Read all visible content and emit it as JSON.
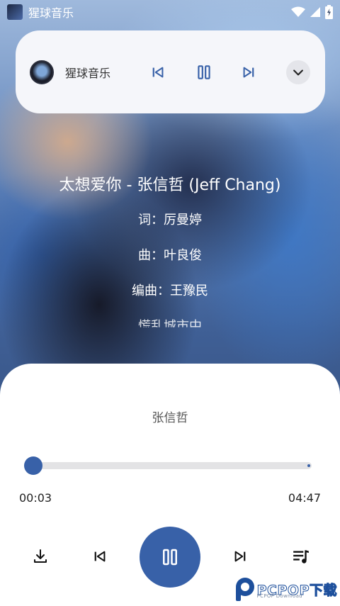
{
  "status_bar": {
    "app_name": "猩球音乐"
  },
  "mini_player": {
    "title": "猩球音乐"
  },
  "lyrics": {
    "lines": [
      "太想爱你 - 张信哲 (Jeff Chang)",
      "词：厉曼婷",
      "曲：叶良俊",
      "编曲：王豫民",
      "慌乱城市中"
    ]
  },
  "player": {
    "artist": "张信哲",
    "progress_fraction": 0.01,
    "current_time": "00:03",
    "total_time": "04:47"
  },
  "watermark": {
    "brand": "PCPOP下载",
    "sub": "PCPOP Download"
  },
  "colors": {
    "accent": "#3861a8",
    "sheet_bg": "#ffffff",
    "card_bg": "#f5f6fa"
  }
}
